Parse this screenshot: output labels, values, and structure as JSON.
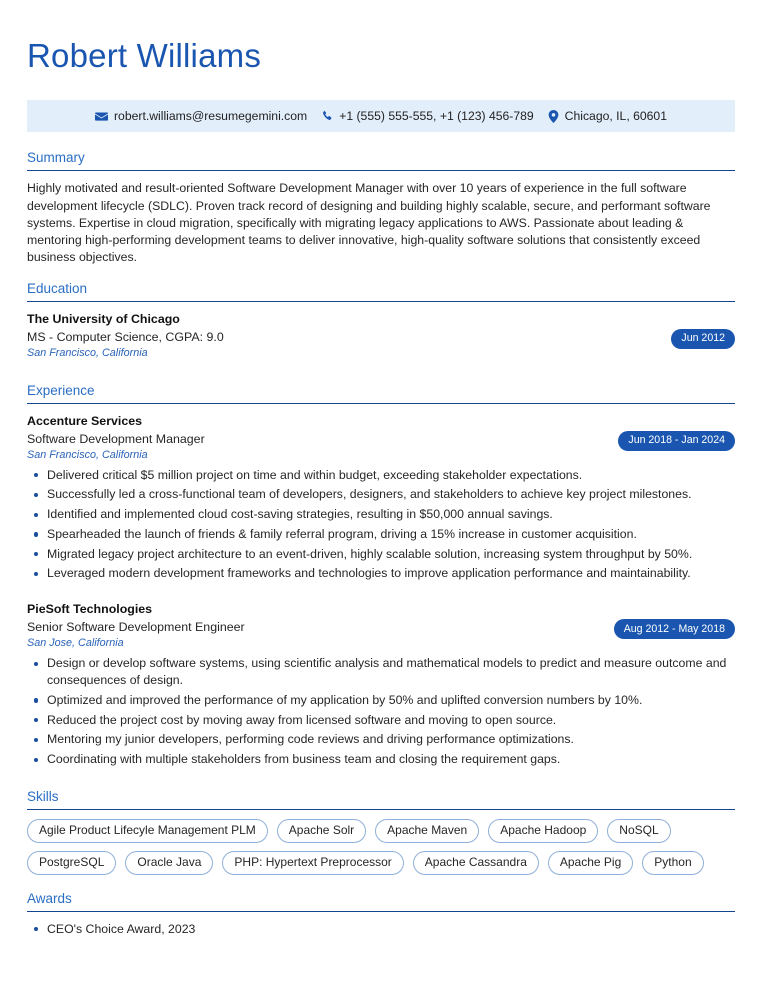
{
  "header": {
    "name": "Robert Williams"
  },
  "contact": {
    "email": "robert.williams@resumegemini.com",
    "phone": "+1 (555) 555-555, +1 (123) 456-789",
    "location": "Chicago, IL, 60601",
    "email_icon": "envelope-icon",
    "phone_icon": "phone-icon",
    "location_icon": "map-pin-icon",
    "background_color": "#e3eefb"
  },
  "theme": {
    "accent_blue": "#1a56b0",
    "heading_blue": "#2a6ec4",
    "rule_blue": "#16458f",
    "badge_blue": "#1a56b0"
  },
  "sections": {
    "summary": {
      "title": "Summary",
      "text": "Highly motivated and result-oriented Software Development Manager with over 10 years of experience in the full software development lifecycle (SDLC). Proven track record of designing and building highly scalable, secure, and performant software systems. Expertise in cloud migration, specifically with migrating legacy applications to AWS. Passionate about leading & mentoring high-performing development teams to deliver innovative, high-quality software solutions that consistently exceed business objectives."
    },
    "education": {
      "title": "Education",
      "entries": [
        {
          "institution": "The University of Chicago",
          "degree": "MS - Computer Science, CGPA: 9.0",
          "location": "San Francisco, California",
          "date": "Jun 2012"
        }
      ]
    },
    "experience": {
      "title": "Experience",
      "entries": [
        {
          "company": "Accenture Services",
          "role": "Software Development Manager",
          "location": "San Francisco, California",
          "date": "Jun 2018 - Jan 2024",
          "bullets": [
            "Delivered critical $5 million project on time and within budget, exceeding stakeholder expectations.",
            "Successfully led a cross-functional team of developers, designers, and stakeholders to achieve key project milestones.",
            "Identified and implemented cloud cost-saving strategies, resulting in $50,000 annual savings.",
            "Spearheaded the launch of friends & family referral program, driving a 15% increase in customer acquisition.",
            "Migrated legacy project architecture to an event-driven, highly scalable solution, increasing system throughput by 50%.",
            "Leveraged modern development frameworks and technologies to improve application performance and maintainability."
          ]
        },
        {
          "company": "PieSoft Technologies",
          "role": "Senior Software Development Engineer",
          "location": "San Jose, California",
          "date": "Aug 2012 - May 2018",
          "bullets": [
            "Design or develop software systems, using scientific analysis and mathematical models to predict and measure outcome and consequences of design.",
            "Optimized and improved the performance of my application by 50% and uplifted conversion numbers by 10%.",
            "Reduced the project cost by moving away from licensed software and moving to open source.",
            "Mentoring my junior developers, performing code reviews and driving performance optimizations.",
            "Coordinating with multiple stakeholders from business team and closing the requirement gaps."
          ]
        }
      ]
    },
    "skills": {
      "title": "Skills",
      "items": [
        "Agile Product Lifecyle Management PLM",
        "Apache Solr",
        "Apache Maven",
        "Apache Hadoop",
        "NoSQL",
        "PostgreSQL",
        "Oracle Java",
        "PHP: Hypertext Preprocessor",
        "Apache Cassandra",
        "Apache Pig",
        "Python"
      ]
    },
    "awards": {
      "title": "Awards",
      "items": [
        "CEO's Choice Award, 2023"
      ]
    }
  }
}
